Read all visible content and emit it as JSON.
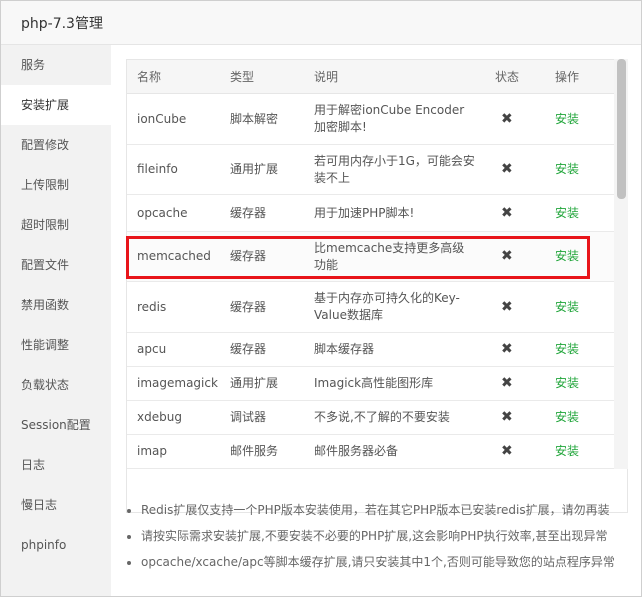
{
  "window": {
    "title": "php-7.3管理"
  },
  "sidebar": {
    "items": [
      {
        "label": "服务"
      },
      {
        "label": "安装扩展"
      },
      {
        "label": "配置修改"
      },
      {
        "label": "上传限制"
      },
      {
        "label": "超时限制"
      },
      {
        "label": "配置文件"
      },
      {
        "label": "禁用函数"
      },
      {
        "label": "性能调整"
      },
      {
        "label": "负载状态"
      },
      {
        "label": "Session配置"
      },
      {
        "label": "日志"
      },
      {
        "label": "慢日志"
      },
      {
        "label": "phpinfo"
      }
    ],
    "active_index": 1
  },
  "table": {
    "headers": {
      "name": "名称",
      "type": "类型",
      "desc": "说明",
      "state": "状态",
      "op": "操作"
    },
    "rows": [
      {
        "name": "ionCube",
        "type": "脚本解密",
        "desc": "用于解密ionCube Encoder加密脚本!",
        "state_icon": "x-icon",
        "op": "安装"
      },
      {
        "name": "fileinfo",
        "type": "通用扩展",
        "desc": "若可用内存小于1G，可能会安装不上",
        "state_icon": "x-icon",
        "op": "安装"
      },
      {
        "name": "opcache",
        "type": "缓存器",
        "desc": "用于加速PHP脚本!",
        "state_icon": "x-icon",
        "op": "安装"
      },
      {
        "name": "memcached",
        "type": "缓存器",
        "desc": "比memcache支持更多高级功能",
        "state_icon": "x-icon",
        "op": "安装"
      },
      {
        "name": "redis",
        "type": "缓存器",
        "desc": "基于内存亦可持久化的Key-Value数据库",
        "state_icon": "x-icon",
        "op": "安装"
      },
      {
        "name": "apcu",
        "type": "缓存器",
        "desc": "脚本缓存器",
        "state_icon": "x-icon",
        "op": "安装"
      },
      {
        "name": "imagemagick",
        "type": "通用扩展",
        "desc": "Imagick高性能图形库",
        "state_icon": "x-icon",
        "op": "安装"
      },
      {
        "name": "xdebug",
        "type": "调试器",
        "desc": "不多说,不了解的不要安装",
        "state_icon": "x-icon",
        "op": "安装"
      },
      {
        "name": "imap",
        "type": "邮件服务",
        "desc": "邮件服务器必备",
        "state_icon": "x-icon",
        "op": "安装"
      }
    ],
    "highlighted_row": "memcached"
  },
  "notes": [
    "Redis扩展仅支持一个PHP版本安装使用，若在其它PHP版本已安装redis扩展，请勿再装",
    "请按实际需求安装扩展,不要安装不必要的PHP扩展,这会影响PHP执行效率,甚至出现异常",
    "opcache/xcache/apc等脚本缓存扩展,请只安装其中1个,否则可能导致您的站点程序异常"
  ],
  "colors": {
    "install": "#20a53a",
    "highlight": "#e8141a"
  }
}
